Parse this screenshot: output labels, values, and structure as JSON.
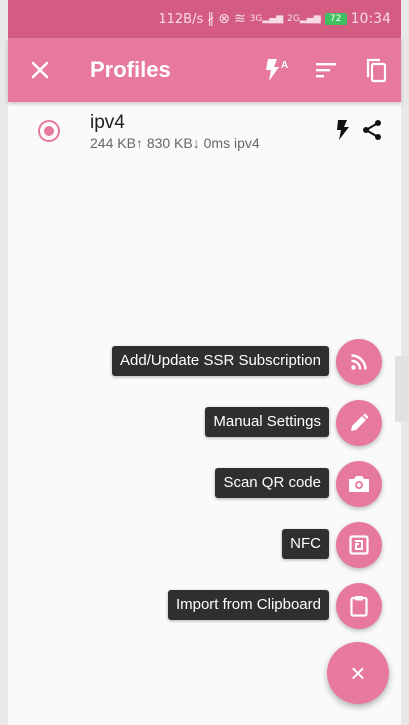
{
  "status_bar": {
    "speed": "112B/s",
    "net_1": "3G",
    "net_2": "2G",
    "battery": "72",
    "time": "10:34"
  },
  "toolbar": {
    "title": "Profiles",
    "close_icon": "close-icon",
    "actions": [
      "auto-flash-icon",
      "sort-icon",
      "copy-icon"
    ]
  },
  "profile": {
    "name": "ipv4",
    "stats": "244 KB↑ 830 KB↓ 0ms  ipv4",
    "selected": true
  },
  "fab_menu": [
    {
      "label": "Add/Update SSR Subscription",
      "icon": "rss-icon"
    },
    {
      "label": "Manual Settings",
      "icon": "pencil-icon"
    },
    {
      "label": "Scan QR code",
      "icon": "camera-icon"
    },
    {
      "label": "NFC",
      "icon": "nfc-icon"
    },
    {
      "label": "Import from Clipboard",
      "icon": "clipboard-icon"
    }
  ],
  "main_fab": {
    "label": "×",
    "icon": "close-icon"
  },
  "colors": {
    "status_bar": "#d45c83",
    "toolbar": "#e7799d",
    "accent": "#e7799d",
    "label_bg": "#2f2f2f"
  }
}
